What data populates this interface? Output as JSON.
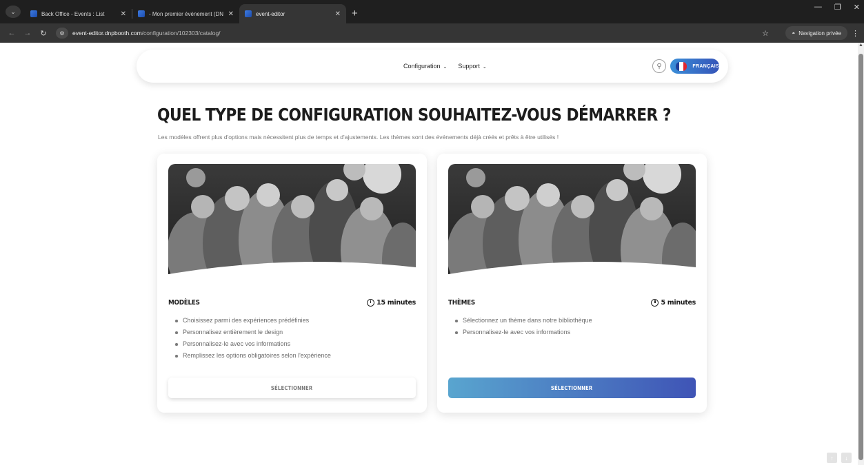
{
  "browser": {
    "tabs": [
      {
        "title": "Back Office - Events : List",
        "active": false
      },
      {
        "title": "- Mon premier événement (DN",
        "active": false
      },
      {
        "title": "event-editor",
        "active": true
      }
    ],
    "new_tab_label": "+",
    "url_host": "event-editor.dnpbooth.com",
    "url_path": "/configuration/102303/catalog/",
    "private_label": "Navigation privée"
  },
  "nav": {
    "links": [
      {
        "label": "Configuration"
      },
      {
        "label": "Support"
      }
    ],
    "language_label": "FRANÇAIS",
    "flag_colors": [
      "#1f3f9a",
      "#ffffff",
      "#e2252e"
    ]
  },
  "page": {
    "heading": "QUEL TYPE DE CONFIGURATION SOUHAITEZ-VOUS DÉMARRER ?",
    "subtitle": "Les modèles offrent plus d'options mais nécessitent plus de temps et d'ajustements. Les thèmes sont des événements déjà créés et prêts à être utilisés !"
  },
  "cards": [
    {
      "title": "MODÈLES",
      "duration": "15 minutes",
      "features": [
        "Choisissez parmi des expériences prédéfinies",
        "Personnalisez entièrement le design",
        "Personnalisez-le avec vos informations",
        "Remplissez les options obligatoires selon l'expérience"
      ],
      "button_label": "SÉLECTIONNER"
    },
    {
      "title": "THÈMES",
      "duration": "5 minutes",
      "features": [
        "Sélectionnez un thème dans notre bibliothèque",
        "Personnalisez-le avec vos informations"
      ],
      "button_label": "SÉLECTIONNER"
    }
  ],
  "colors": {
    "accent_start": "#59a5cf",
    "accent_end": "#3f54b6"
  }
}
